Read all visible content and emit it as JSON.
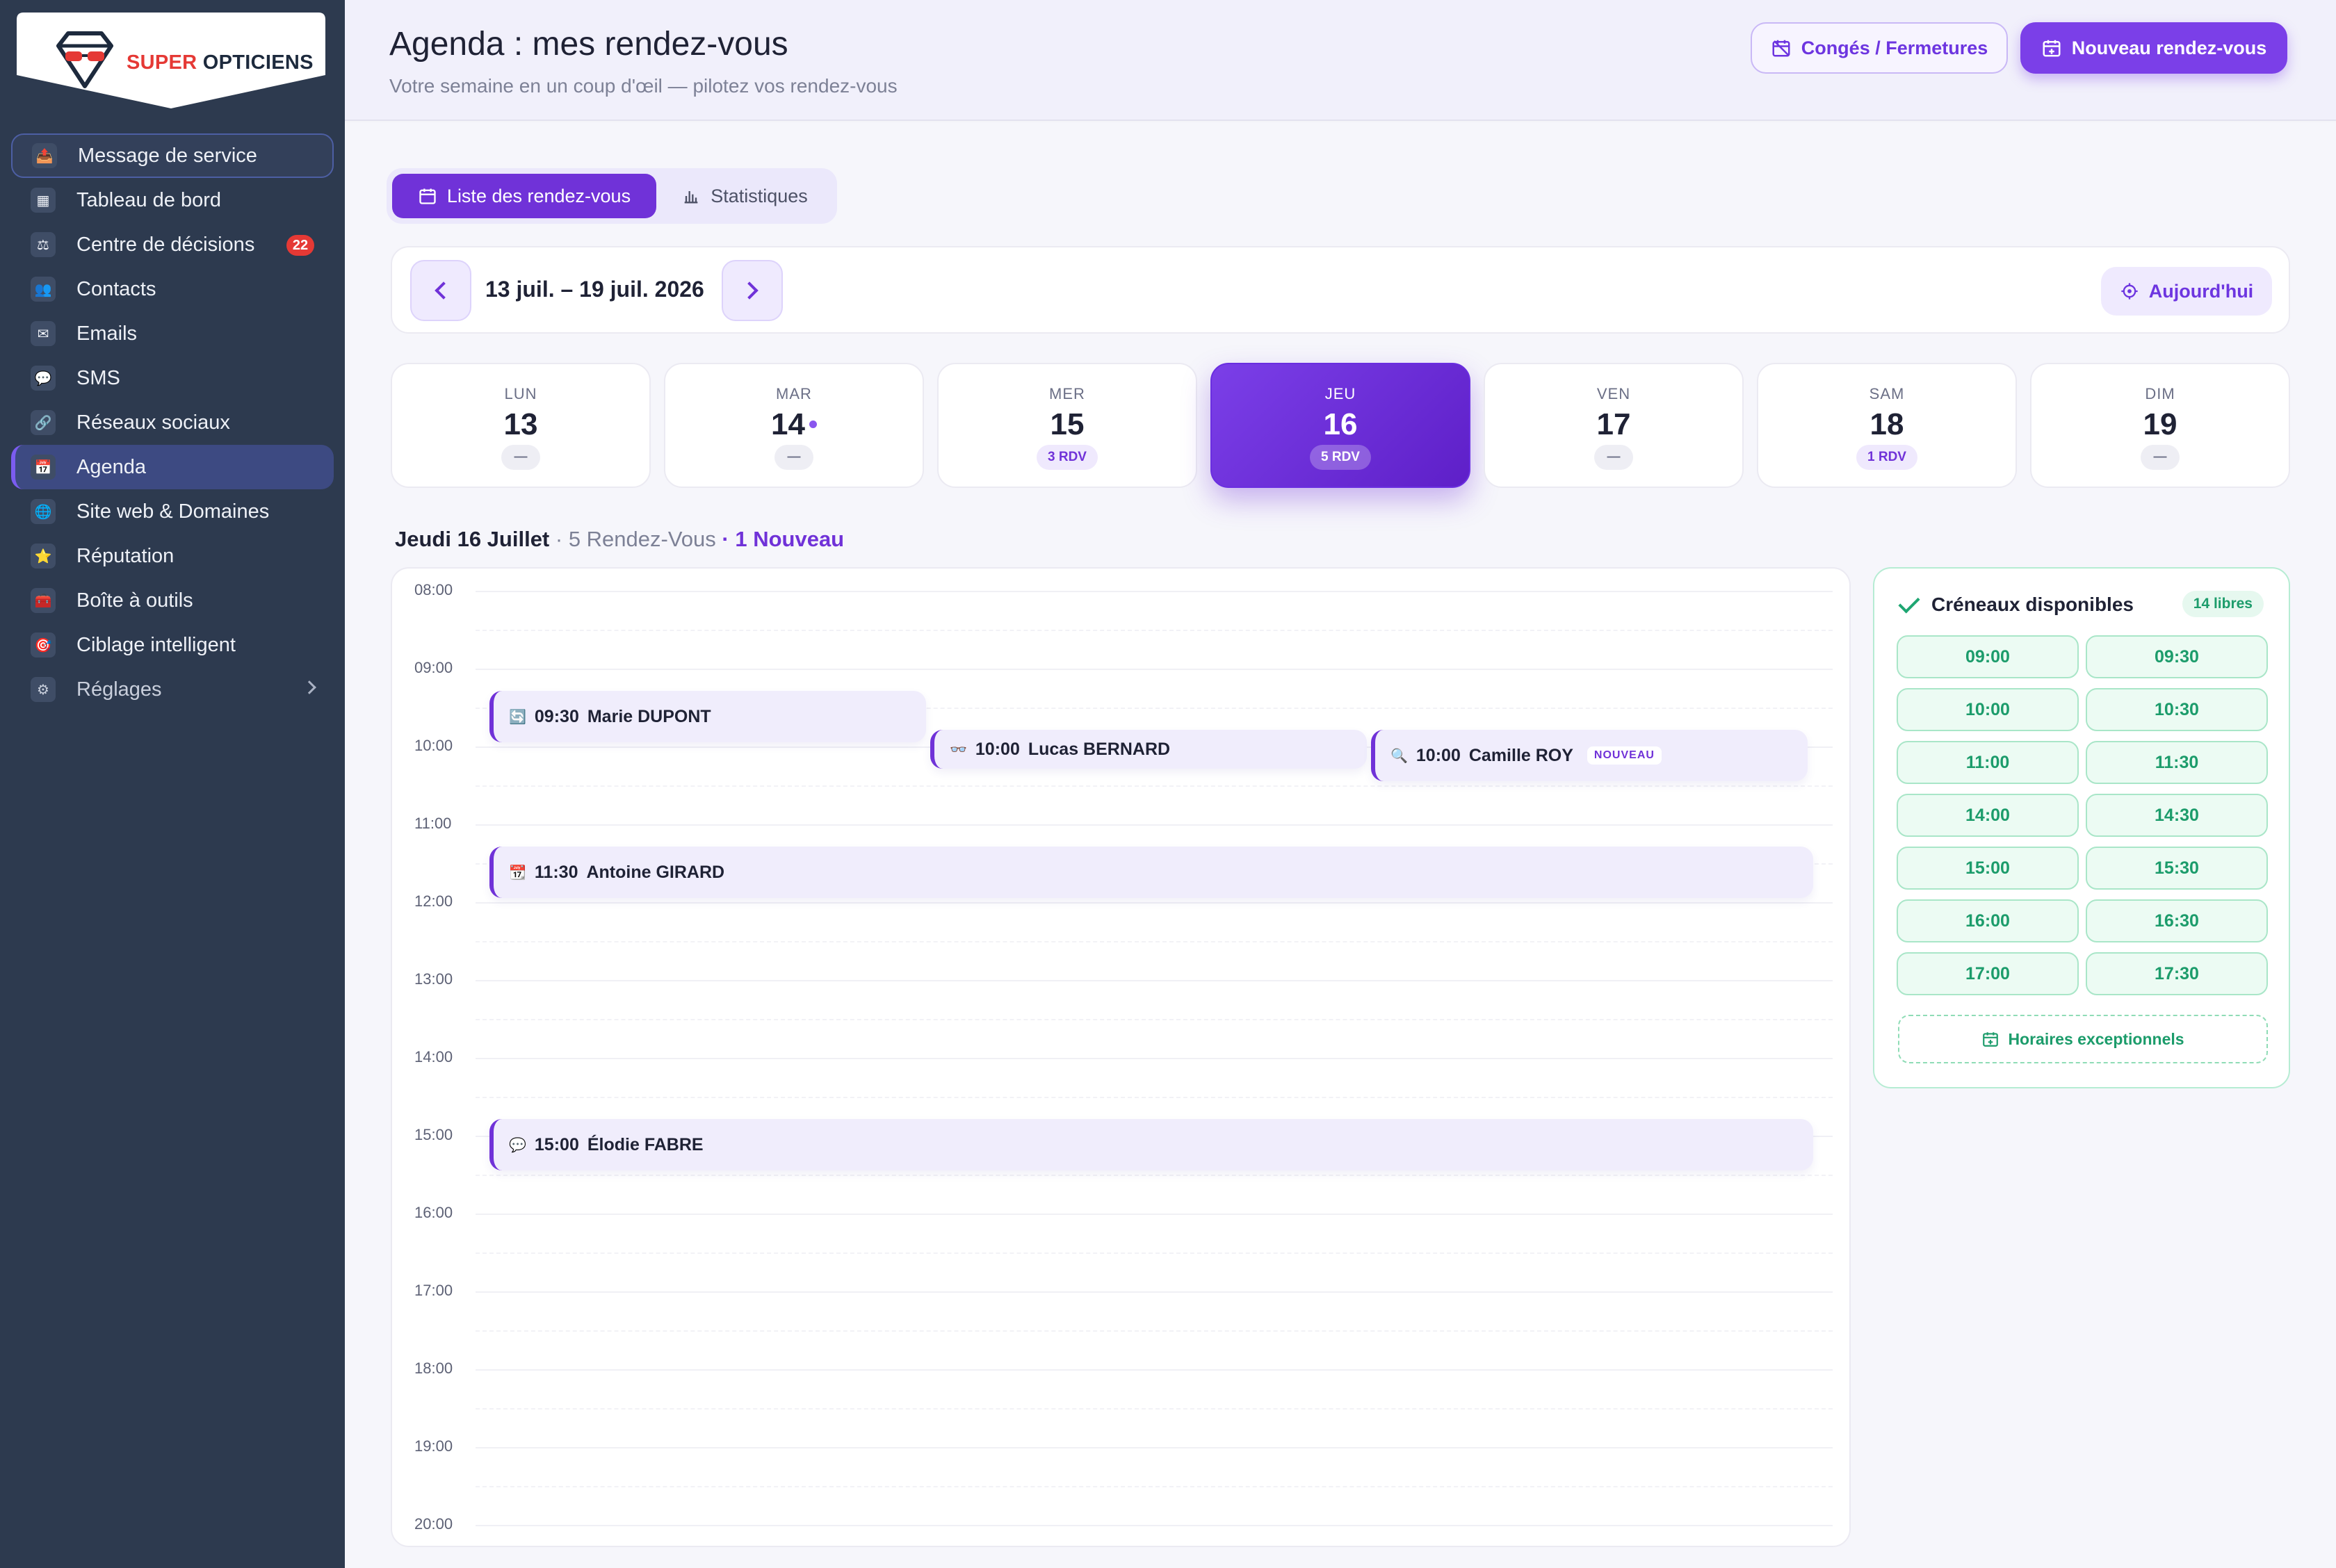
{
  "brand": {
    "part1": "SUPER",
    "part2": "OPTICIENS"
  },
  "sidebar": {
    "items": [
      {
        "label": "Message de service",
        "icon": "📤"
      },
      {
        "label": "Tableau de bord",
        "icon": "▦"
      },
      {
        "label": "Centre de décisions",
        "icon": "⚖",
        "badge": "22"
      },
      {
        "label": "Contacts",
        "icon": "👥"
      },
      {
        "label": "Emails",
        "icon": "✉"
      },
      {
        "label": "SMS",
        "icon": "💬"
      },
      {
        "label": "Réseaux sociaux",
        "icon": "🔗"
      },
      {
        "label": "Agenda",
        "icon": "📅"
      },
      {
        "label": "Site web & Domaines",
        "icon": "🌐"
      },
      {
        "label": "Réputation",
        "icon": "⭐"
      },
      {
        "label": "Boîte à outils",
        "icon": "🧰"
      },
      {
        "label": "Ciblage intelligent",
        "icon": "🎯"
      },
      {
        "label": "Réglages",
        "icon": "⚙"
      }
    ]
  },
  "header": {
    "title": "Agenda : mes rendez-vous",
    "subtitle": "Votre semaine en un coup d'œil — pilotez vos rendez-vous",
    "conges_label": "Congés / Fermetures",
    "new_label": "Nouveau rendez-vous"
  },
  "tabs": {
    "list_label": "Liste des rendez-vous",
    "stats_label": "Statistiques"
  },
  "week": {
    "range": "13 juil. – 19 juil. 2026",
    "today_label": "Aujourd'hui"
  },
  "days": [
    {
      "name": "LUN",
      "date": "13",
      "count": "—"
    },
    {
      "name": "MAR",
      "date": "14",
      "count": "—"
    },
    {
      "name": "MER",
      "date": "15",
      "count": "3 RDV"
    },
    {
      "name": "JEU",
      "date": "16",
      "count": "5 RDV"
    },
    {
      "name": "VEN",
      "date": "17",
      "count": "—"
    },
    {
      "name": "SAM",
      "date": "18",
      "count": "1 RDV"
    },
    {
      "name": "DIM",
      "date": "19",
      "count": "—"
    }
  ],
  "day_heading": {
    "date": "Jeudi 16 Juillet",
    "count": " · 5 Rendez-Vous",
    "new": " · 1 Nouveau"
  },
  "hours": [
    "08:00",
    "09:00",
    "10:00",
    "11:00",
    "12:00",
    "13:00",
    "14:00",
    "15:00",
    "16:00",
    "17:00",
    "18:00",
    "19:00",
    "20:00"
  ],
  "appointments": [
    {
      "time": "09:30",
      "name": "Marie DUPONT",
      "icon": "🔄"
    },
    {
      "time": "10:00",
      "name": "Lucas BERNARD",
      "icon": "👓"
    },
    {
      "time": "10:00",
      "name": "Camille ROY",
      "icon": "🔍",
      "tag": "NOUVEAU"
    },
    {
      "time": "11:30",
      "name": "Antoine GIRARD",
      "icon": "📆"
    },
    {
      "time": "15:00",
      "name": "Élodie FABRE",
      "icon": "💬"
    }
  ],
  "slots": {
    "title": "Créneaux disponibles",
    "badge": "14 libres",
    "times": [
      "09:00",
      "09:30",
      "10:00",
      "10:30",
      "11:00",
      "11:30",
      "14:00",
      "14:30",
      "15:00",
      "15:30",
      "16:00",
      "16:30",
      "17:00",
      "17:30"
    ],
    "exceptional_label": "Horaires exceptionnels"
  },
  "colors": {
    "accent": "#7032d8",
    "sidebar": "#2d3a4f",
    "success": "#1c9c6b",
    "danger": "#e53935"
  }
}
